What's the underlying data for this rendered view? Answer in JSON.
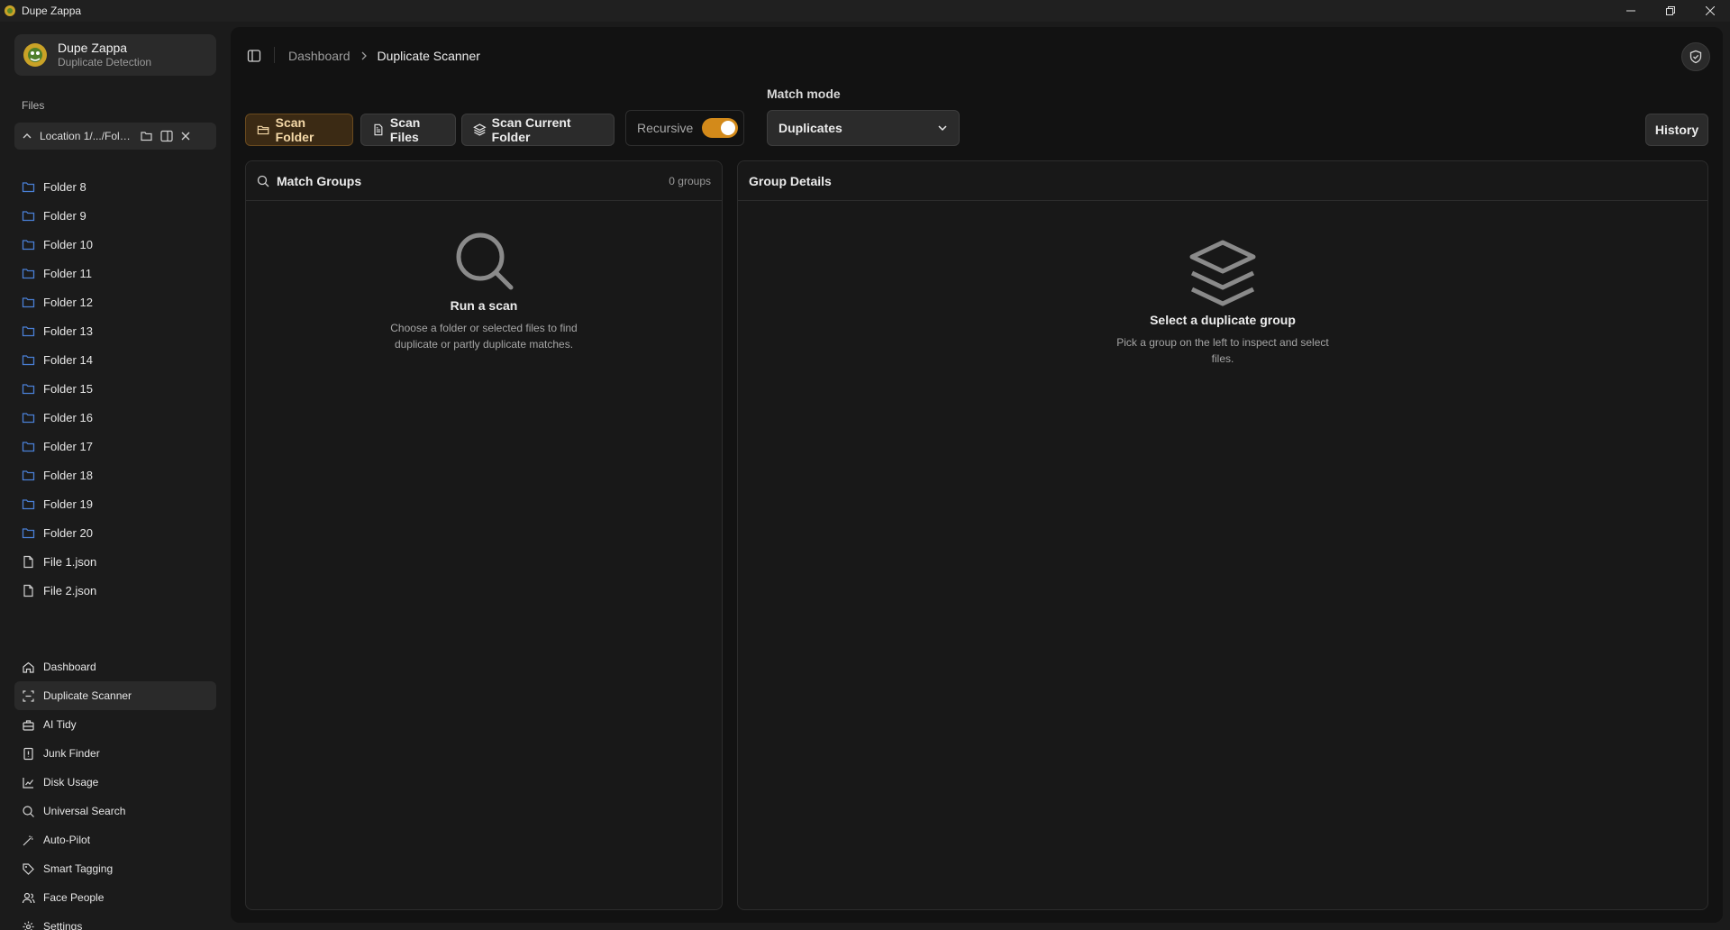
{
  "window": {
    "title": "Dupe Zappa"
  },
  "brand": {
    "name": "Dupe Zappa",
    "subtitle": "Duplicate Detection"
  },
  "files": {
    "label": "Files",
    "location": "Location 1/.../Fold...",
    "items": [
      {
        "label": "Folder 8",
        "type": "folder"
      },
      {
        "label": "Folder 9",
        "type": "folder"
      },
      {
        "label": "Folder 10",
        "type": "folder"
      },
      {
        "label": "Folder 11",
        "type": "folder"
      },
      {
        "label": "Folder 12",
        "type": "folder"
      },
      {
        "label": "Folder 13",
        "type": "folder"
      },
      {
        "label": "Folder 14",
        "type": "folder"
      },
      {
        "label": "Folder 15",
        "type": "folder"
      },
      {
        "label": "Folder 16",
        "type": "folder"
      },
      {
        "label": "Folder 17",
        "type": "folder"
      },
      {
        "label": "Folder 18",
        "type": "folder"
      },
      {
        "label": "Folder 19",
        "type": "folder"
      },
      {
        "label": "Folder 20",
        "type": "folder"
      },
      {
        "label": "File 1.json",
        "type": "file"
      },
      {
        "label": "File 2.json",
        "type": "file"
      }
    ]
  },
  "nav": {
    "items": [
      {
        "label": "Dashboard",
        "icon": "home-icon"
      },
      {
        "label": "Duplicate Scanner",
        "icon": "scanner-icon",
        "active": true
      },
      {
        "label": "AI Tidy",
        "icon": "briefcase-icon"
      },
      {
        "label": "Junk Finder",
        "icon": "alert-file-icon"
      },
      {
        "label": "Disk Usage",
        "icon": "chart-icon"
      },
      {
        "label": "Universal Search",
        "icon": "search-icon"
      },
      {
        "label": "Auto-Pilot",
        "icon": "wand-icon"
      },
      {
        "label": "Smart Tagging",
        "icon": "tag-icon"
      },
      {
        "label": "Face People",
        "icon": "users-icon"
      },
      {
        "label": "Settings",
        "icon": "gear-icon"
      }
    ]
  },
  "breadcrumb": {
    "parent": "Dashboard",
    "current": "Duplicate Scanner"
  },
  "toolbar": {
    "scan_folder": "Scan Folder",
    "scan_files": "Scan Files",
    "scan_current_folder": "Scan Current Folder",
    "recursive_label": "Recursive",
    "recursive_on": true,
    "match_mode_label": "Match mode",
    "match_mode_value": "Duplicates",
    "history": "History"
  },
  "match_groups": {
    "title": "Match Groups",
    "count": "0 groups",
    "empty_title": "Run a scan",
    "empty_desc": "Choose a folder or selected files to find duplicate or partly duplicate matches."
  },
  "group_details": {
    "title": "Group Details",
    "empty_title": "Select a duplicate group",
    "empty_desc": "Pick a group on the left to inspect and select files."
  },
  "colors": {
    "accent": "#d38a1a",
    "background": "#121212",
    "sidebar": "#1b1b1b"
  }
}
